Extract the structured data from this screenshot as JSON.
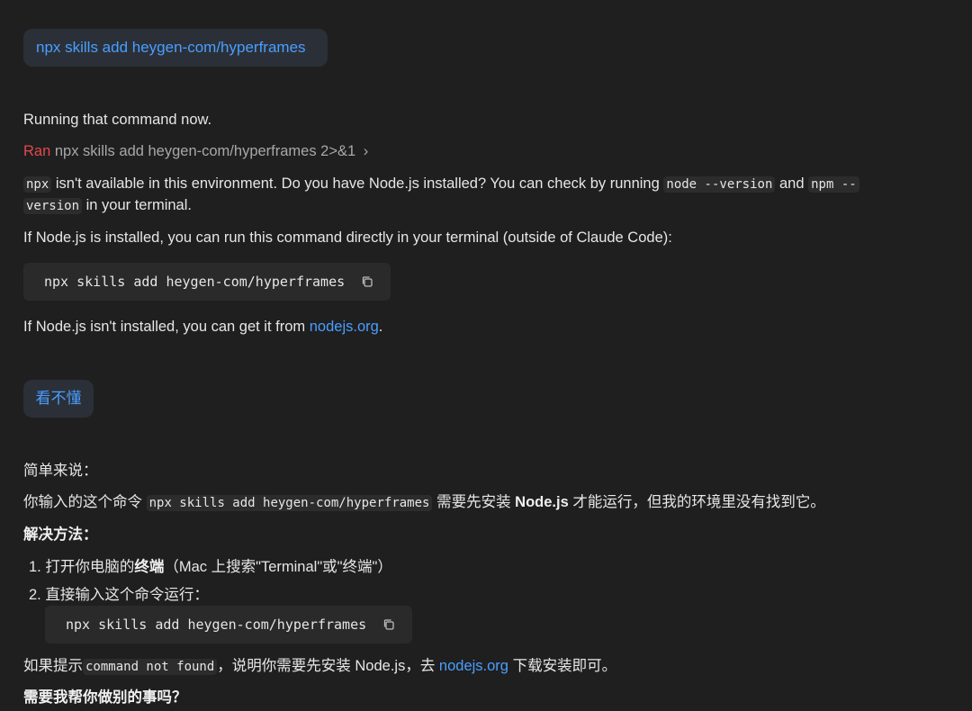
{
  "user_message_1": "npx skills add heygen-com/hyperframes",
  "assistant_1": {
    "intro": "Running that command now.",
    "tool_call": {
      "verb": "Ran",
      "command": "npx skills add heygen-com/hyperframes 2>&1",
      "chevron": "›"
    },
    "para1": {
      "code_npx": "npx",
      "text_a": "isn't available in this environment. Do you have Node.js installed? You can check by running",
      "code_node": "node --version",
      "text_and": "and",
      "code_npm_1": "npm --",
      "code_npm_2": "version",
      "text_b": "in your terminal."
    },
    "para2": "If Node.js is installed, you can run this command directly in your terminal (outside of Claude Code):",
    "codeblock": "npx skills add heygen-com/hyperframes",
    "para3": {
      "text": "If Node.js isn't installed, you can get it from",
      "link": "nodejs.org",
      "end": "."
    }
  },
  "user_message_2": "看不懂",
  "assistant_2": {
    "summary": "简单来说：",
    "line1": {
      "a": "你输入的这个命令",
      "code": "npx skills add heygen-com/hyperframes",
      "b": "需要先安装",
      "bold": "Node.js",
      "c": "才能运行，但我的环境里没有找到它。"
    },
    "solution_heading": "解决方法：",
    "steps": [
      {
        "num": "1.",
        "a": "打开你电脑的",
        "bold": "终端",
        "b": "（Mac 上搜索\"Terminal\"或\"终端\"）"
      },
      {
        "num": "2.",
        "a": "直接输入这个命令运行："
      }
    ],
    "codeblock": "npx skills add heygen-com/hyperframes",
    "hint": {
      "a": "如果提示",
      "code": "command not found",
      "b": "，说明你需要先安装 Node.js，去",
      "link": "nodejs.org",
      "c": "下载安装即可。"
    },
    "closing": "需要我帮你做别的事吗？"
  }
}
